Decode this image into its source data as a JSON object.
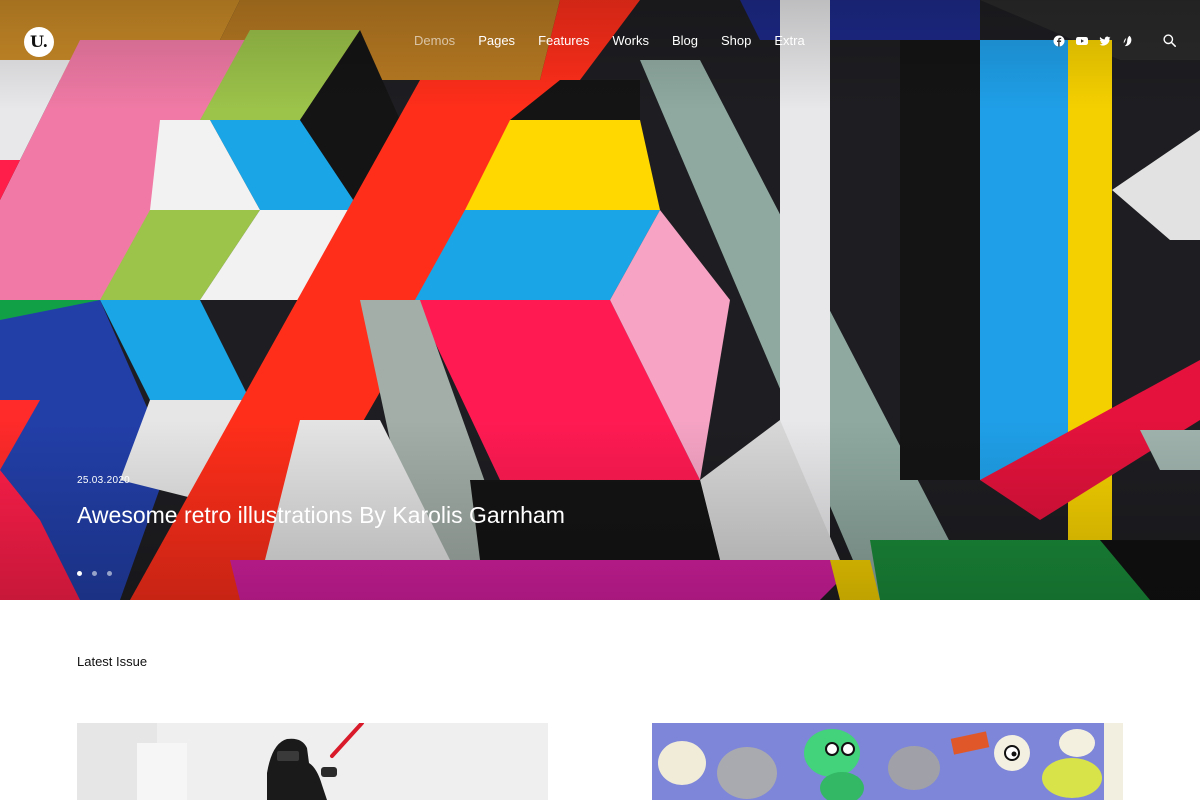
{
  "logo": {
    "text": "U."
  },
  "nav": {
    "items": [
      "Demos",
      "Pages",
      "Features",
      "Works",
      "Blog",
      "Shop",
      "Extra"
    ]
  },
  "social": {
    "icons": [
      "facebook-icon",
      "youtube-icon",
      "twitter-icon",
      "dribbble-icon"
    ]
  },
  "hero": {
    "date": "25.03.2020",
    "title": "Awesome retro illustrations By Karolis Garnham",
    "slides": 3,
    "active_slide": 1
  },
  "section": {
    "label": "Latest Issue"
  }
}
